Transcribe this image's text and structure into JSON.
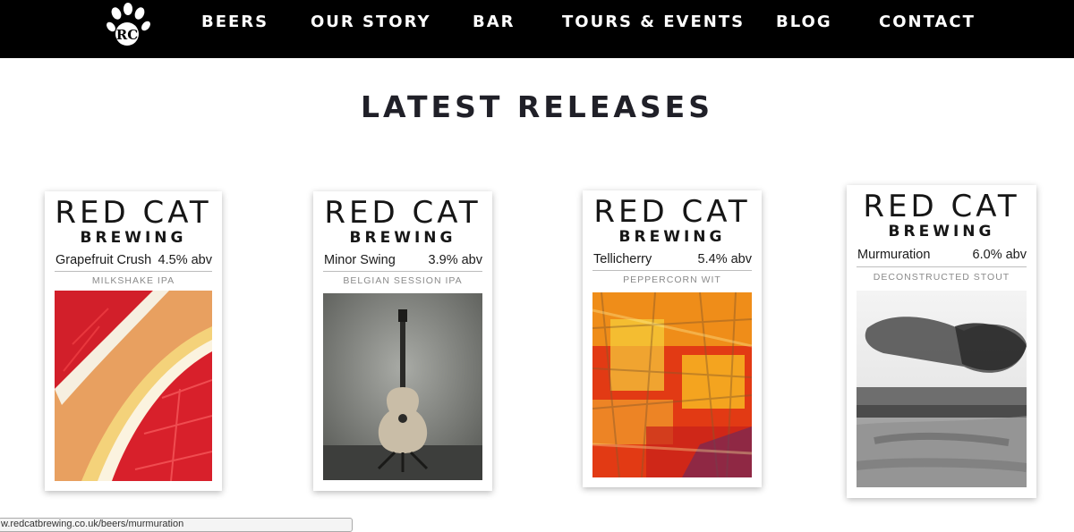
{
  "nav": {
    "logo_text": "RC",
    "items": [
      {
        "label": "BEERS"
      },
      {
        "label": "OUR STORY"
      },
      {
        "label": "BAR"
      },
      {
        "label": "TOURS & EVENTS"
      },
      {
        "label": "BLOG"
      },
      {
        "label": "CONTACT"
      }
    ]
  },
  "main": {
    "heading": "LATEST RELEASES",
    "cards": [
      {
        "brand": "RED CAT",
        "brand_sub": "BREWING",
        "name": "Grapefruit Crush",
        "abv": "4.5% abv",
        "style": "MILKSHAKE IPA",
        "image": "grapefruit"
      },
      {
        "brand": "RED CAT",
        "brand_sub": "BREWING",
        "name": "Minor Swing",
        "abv": "3.9% abv",
        "style": "BELGIAN SESSION IPA",
        "image": "guitar"
      },
      {
        "brand": "RED CAT",
        "brand_sub": "BREWING",
        "name": "Tellicherry",
        "abv": "5.4% abv",
        "style": "PEPPERCORN WIT",
        "image": "abstract-paint"
      },
      {
        "brand": "RED CAT",
        "brand_sub": "BREWING",
        "name": "Murmuration",
        "abv": "6.0% abv",
        "style": "DECONSTRUCTED STOUT",
        "image": "starling-murmuration"
      }
    ]
  },
  "status_bar": {
    "url": "w.redcatbrewing.co.uk/beers/murmuration"
  },
  "colors": {
    "nav_bg": "#000000",
    "nav_text": "#ffffff",
    "heading": "#202028"
  }
}
